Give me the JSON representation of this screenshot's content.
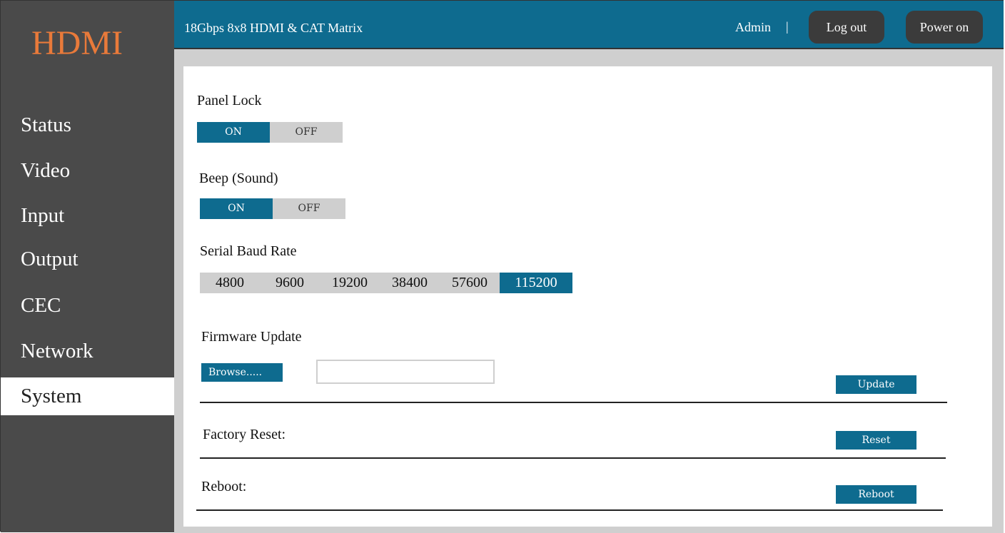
{
  "logo": "HDMI",
  "sidebar": {
    "items": [
      {
        "label": "Status"
      },
      {
        "label": "Video"
      },
      {
        "label": "Input"
      },
      {
        "label": "Output"
      },
      {
        "label": "CEC"
      },
      {
        "label": "Network"
      },
      {
        "label": "System"
      }
    ],
    "active": "System"
  },
  "header": {
    "title": "18Gbps 8x8 HDMI & CAT Matrix",
    "user": "Admin",
    "separator": "|",
    "logout_label": "Log out",
    "power_label": "Power on"
  },
  "panel_lock": {
    "label": "Panel Lock",
    "on": "ON",
    "off": "OFF",
    "value": "ON"
  },
  "beep": {
    "label": "Beep (Sound)",
    "on": "ON",
    "off": "OFF",
    "value": "ON"
  },
  "baud": {
    "label": "Serial Baud Rate",
    "options": [
      "4800",
      "9600",
      "19200",
      "38400",
      "57600",
      "115200"
    ],
    "selected": "115200"
  },
  "firmware": {
    "label": "Firmware Update",
    "browse_label": "Browse.....",
    "file_value": "",
    "update_label": "Update"
  },
  "factory_reset": {
    "label": "Factory Reset:",
    "button_label": "Reset"
  },
  "reboot": {
    "label": "Reboot:",
    "button_label": "Reboot"
  },
  "colors": {
    "accent": "#0e6b8f",
    "sidebar": "#4a4a4a",
    "logo": "#e97a3a",
    "inactive": "#cfcfcf"
  }
}
